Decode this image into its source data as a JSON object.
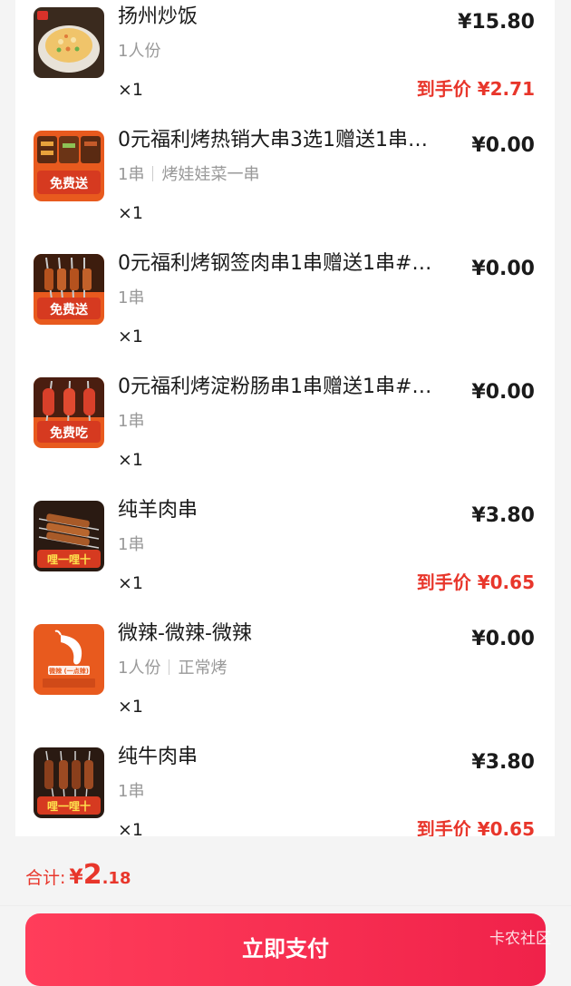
{
  "items": [
    {
      "name": "扬州炒饭",
      "spec": [
        "1人份"
      ],
      "qty": "×1",
      "price": "¥15.80",
      "deal": "到手价 ¥2.71",
      "thumb_icon": "fried-rice-icon"
    },
    {
      "name": "0元福利烤热销大串3选1赠送1串…",
      "spec": [
        "1串",
        "烤娃娃菜一串"
      ],
      "qty": "×1",
      "price": "¥0.00",
      "deal": "",
      "thumb_icon": "skewer-free-icon",
      "badge": "免费送"
    },
    {
      "name": "0元福利烤钢签肉串1串赠送1串#…",
      "spec": [
        "1串"
      ],
      "qty": "×1",
      "price": "¥0.00",
      "deal": "",
      "thumb_icon": "skewer-free-icon",
      "badge": "免费送"
    },
    {
      "name": "0元福利烤淀粉肠串1串赠送1串#…",
      "spec": [
        "1串"
      ],
      "qty": "×1",
      "price": "¥0.00",
      "deal": "",
      "thumb_icon": "sausage-free-icon",
      "badge": "免费吃"
    },
    {
      "name": "纯羊肉串",
      "spec": [
        "1串"
      ],
      "qty": "×1",
      "price": "¥3.80",
      "deal": "到手价 ¥0.65",
      "thumb_icon": "lamb-skewer-icon",
      "badge": "哩一哩十"
    },
    {
      "name": "微辣-微辣-微辣",
      "spec": [
        "1人份",
        "正常烤"
      ],
      "qty": "×1",
      "price": "¥0.00",
      "deal": "",
      "thumb_icon": "chili-icon",
      "badge": "微辣 (一点辣)"
    },
    {
      "name": "纯牛肉串",
      "spec": [
        "1串"
      ],
      "qty": "×1",
      "price": "¥3.80",
      "deal": "到手价 ¥0.65",
      "thumb_icon": "beef-skewer-icon",
      "badge": "哩一哩十"
    }
  ],
  "footer": {
    "total_label": "合计:",
    "total_currency": "¥",
    "total_int": "2",
    "total_dec": ".18",
    "pay_button": "立即支付",
    "watermark": "卡农社区"
  },
  "colors": {
    "accent_red": "#e8362b",
    "pay_gradient": [
      "#ff3d5a",
      "#f0224a"
    ],
    "thumb_orange": "#e85a1e"
  }
}
